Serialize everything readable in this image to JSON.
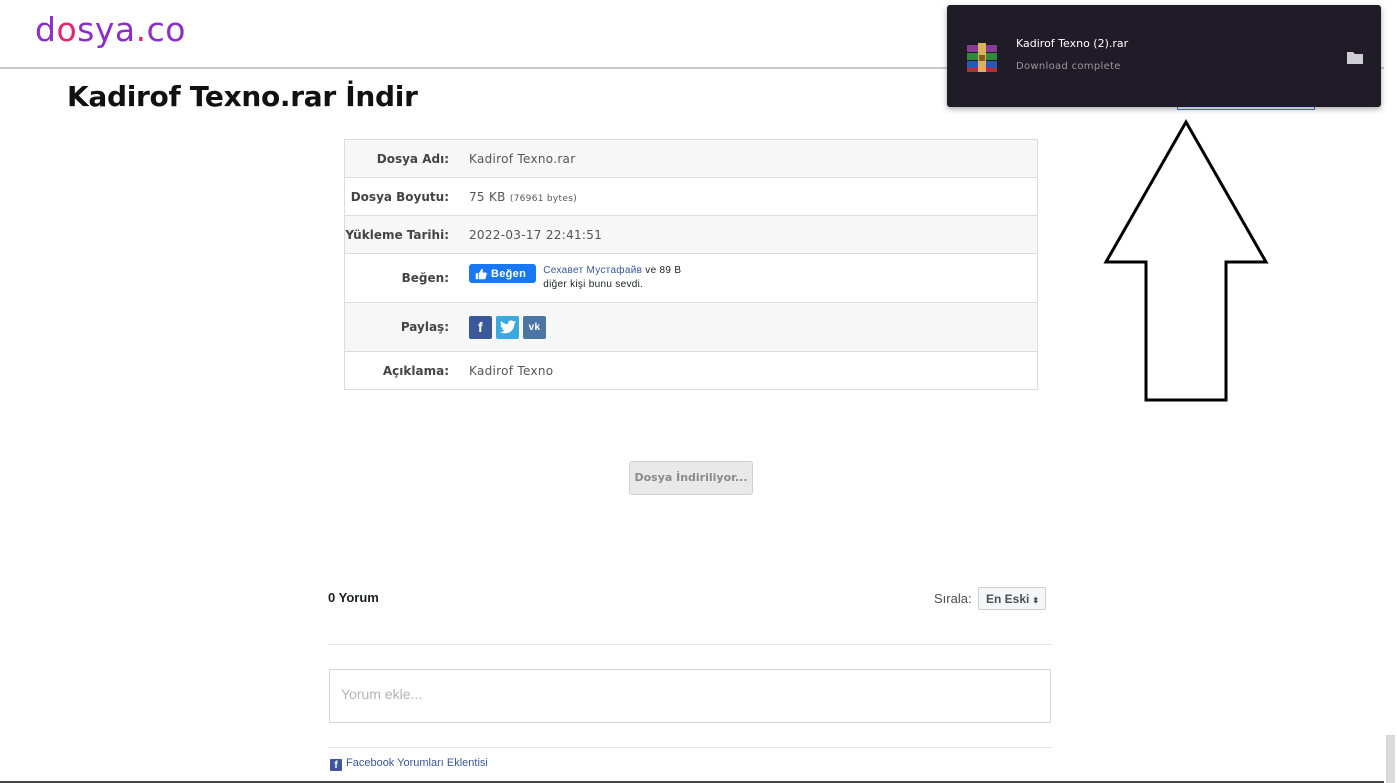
{
  "logo": {
    "main": "d",
    "o": "o",
    "rest": "sya",
    "dot": ".",
    "tail": "co"
  },
  "page": {
    "title": "Kadirof Texno.rar İndir"
  },
  "info": {
    "rows": [
      {
        "label": "Dosya Adı:",
        "value": "Kadirof Texno.rar"
      },
      {
        "label": "Dosya Boyutu:",
        "value": "75 KB",
        "bytes": "(76961 bytes)"
      },
      {
        "label": "Yükleme Tarihi:",
        "value": "2022-03-17 22:41:51"
      },
      {
        "label": "Beğen:"
      },
      {
        "label": "Paylaş:"
      },
      {
        "label": "Açıklama:",
        "value": "Kadirof Texno"
      }
    ],
    "like": {
      "button": "Beğen",
      "name": "Сехавет Мустафайв",
      "line1_suffix": " ve 89 B",
      "line2": "diğer kişi bunu sevdi."
    },
    "share": {
      "facebook": "f",
      "twitter": "t",
      "vk": "vk"
    }
  },
  "download_button": "Dosya İndiriliyor...",
  "comments": {
    "count": "0 Yorum",
    "sort_label": "Sırala:",
    "sort_value": "En Eski",
    "placeholder": "Yorum ekle...",
    "plugin": "Facebook Yorumları Eklentisi"
  },
  "download_popup": {
    "file": "Kadirof Texno (2).rar",
    "status": "Download complete",
    "icons": {
      "file": "winrar-archive-icon",
      "folder": "folder-icon"
    }
  },
  "colors": {
    "logo_purple": "#8b2fc9",
    "logo_pink": "#e6246f",
    "popup_bg": "#201c27",
    "facebook_blue": "#1877f2"
  }
}
